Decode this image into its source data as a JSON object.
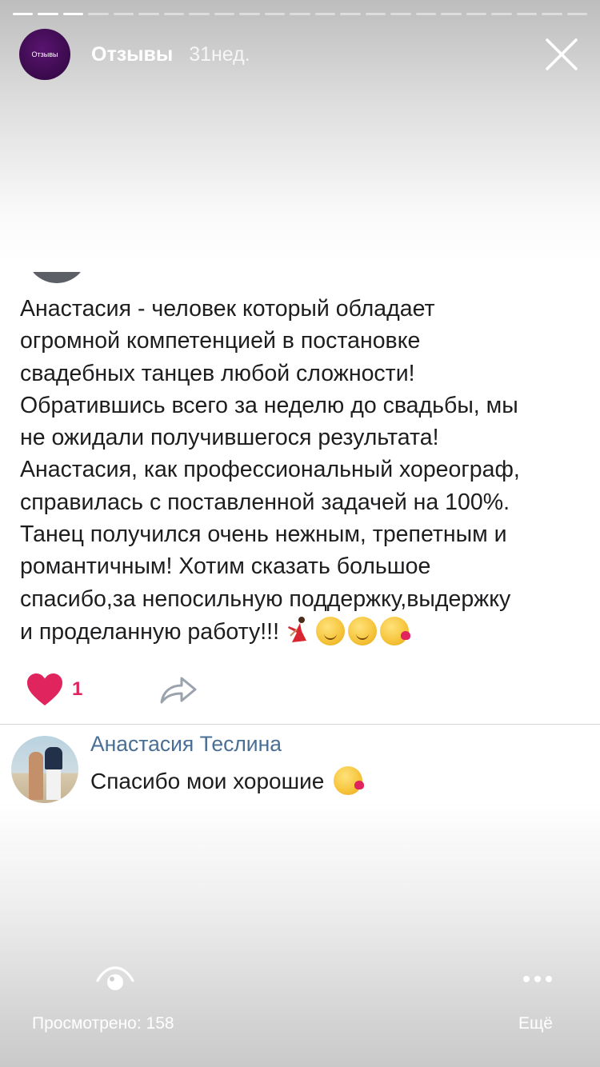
{
  "story": {
    "progress": {
      "total_segments": 23,
      "completed_segments": 3,
      "active_segment": 4
    },
    "account_name": "Отзывы",
    "avatar_text": "Отзывы",
    "time": "31нед.",
    "close_icon": "close-icon"
  },
  "post": {
    "text": "Анастасия - человек который обладает\nогромной компетенцией в постановке\nсвадебных танцев любой сложности!\nОбратившись всего за неделю до свадьбы, мы\nне ожидали получившегося результата!\nАнастасия, как профессиональный хореограф,\nсправилась с поставленной задачей на 100%.\nТанец получился очень нежным, трепетным и\nромантичным! Хотим сказать большое\nспасибо,за непосильную поддержку,выдержку\nи проделанную работу!!!",
    "emojis": [
      "dancer-emoji",
      "smiling-face-emoji",
      "smiling-face-emoji",
      "face-blowing-kiss-emoji"
    ],
    "like_icon": "heart-icon",
    "like_count": "1",
    "share_icon": "share-arrow-icon",
    "accent_color": "#e0245e"
  },
  "comment": {
    "author": "Анастасия Теслина",
    "text": "Спасибо мои хорошие",
    "emoji": "face-blowing-kiss-emoji",
    "author_color": "#4a6f96"
  },
  "footer": {
    "views_icon": "eye-icon",
    "views_label": "Просмотрено: 158",
    "more_icon": "more-dots-icon",
    "more_label": "Ещё"
  }
}
